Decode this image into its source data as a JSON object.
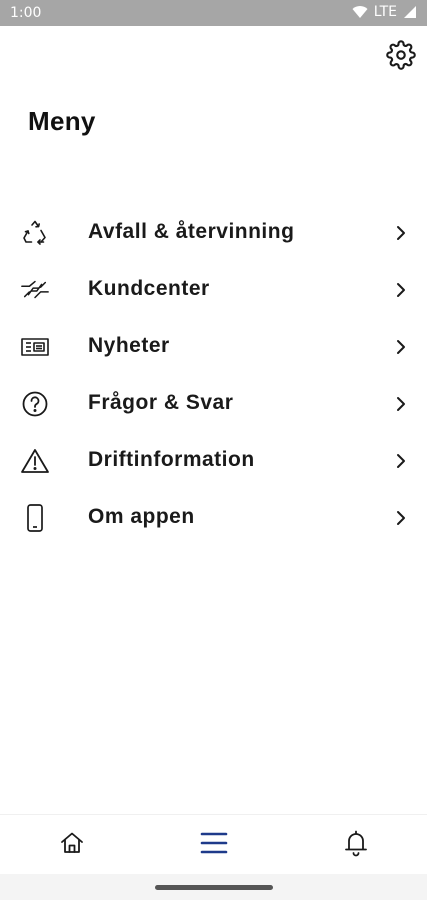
{
  "status_bar": {
    "time": "1:00",
    "network": "LTE"
  },
  "header": {
    "title": "Meny",
    "settings_icon": "gear-icon"
  },
  "menu": {
    "items": [
      {
        "label": "Avfall & återvinning",
        "icon": "recycle-icon"
      },
      {
        "label": "Kundcenter",
        "icon": "handshake-icon"
      },
      {
        "label": "Nyheter",
        "icon": "newspaper-icon"
      },
      {
        "label": "Frågor & Svar",
        "icon": "question-circle-icon"
      },
      {
        "label": "Driftinformation",
        "icon": "warning-triangle-icon"
      },
      {
        "label": "Om appen",
        "icon": "phone-icon"
      }
    ]
  },
  "bottom_nav": {
    "items": [
      {
        "icon": "home-icon",
        "active": false
      },
      {
        "icon": "menu-icon",
        "active": true
      },
      {
        "icon": "bell-icon",
        "active": false
      }
    ],
    "active_color": "#1e3a8a",
    "inactive_color": "#1a1a1a"
  },
  "colors": {
    "status_bar": "#a6a6a6",
    "text": "#1a1a1a",
    "accent": "#1e3a8a"
  }
}
